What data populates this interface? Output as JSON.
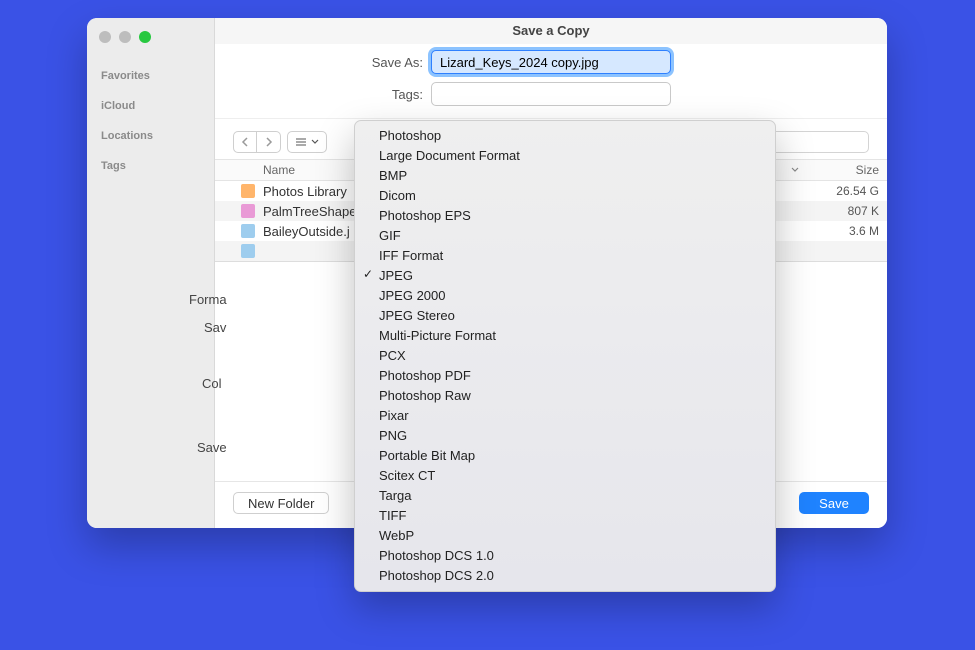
{
  "window": {
    "title": "Save a Copy"
  },
  "sidebar": {
    "sections": [
      "Favorites",
      "iCloud",
      "Locations",
      "Tags"
    ]
  },
  "form": {
    "saveas_label": "Save As:",
    "saveas_value": "Lizard_Keys_2024 copy.jpg",
    "tags_label": "Tags:",
    "tags_value": ""
  },
  "columns": {
    "name": "Name",
    "size": "Size"
  },
  "files": [
    {
      "name": "Photos Library",
      "size": "26.54 G",
      "kind": "lib"
    },
    {
      "name": "PalmTreeShape.",
      "size": "807 K",
      "kind": "img"
    },
    {
      "name": "BaileyOutside.j",
      "size": "3.6 M",
      "kind": "jpg"
    }
  ],
  "option_labels": {
    "format": "Forma",
    "save": "Sav",
    "color": "Col",
    "save_cloud": "Save"
  },
  "buttons": {
    "new_folder": "New Folder",
    "save": "Save"
  },
  "format_menu": {
    "selected": "JPEG",
    "options": [
      "Photoshop",
      "Large Document Format",
      "BMP",
      "Dicom",
      "Photoshop EPS",
      "GIF",
      "IFF Format",
      "JPEG",
      "JPEG 2000",
      "JPEG Stereo",
      "Multi-Picture Format",
      "PCX",
      "Photoshop PDF",
      "Photoshop Raw",
      "Pixar",
      "PNG",
      "Portable Bit Map",
      "Scitex CT",
      "Targa",
      "TIFF",
      "WebP",
      "Photoshop DCS 1.0",
      "Photoshop DCS 2.0"
    ]
  }
}
